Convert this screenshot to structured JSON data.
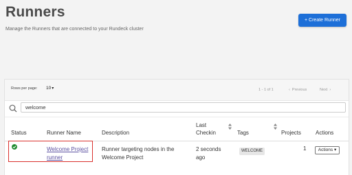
{
  "header": {
    "title": "Runners",
    "subtitle": "Manage the Runners that are connected to your Rundeck cluster",
    "create_button": "+ Create Runner"
  },
  "pager": {
    "rows_per_page_label": "Rows per page:",
    "rows_per_page_value": "10",
    "range": "1 - 1 of 1",
    "previous": "Previous",
    "next": "Next"
  },
  "search": {
    "value": "welcome"
  },
  "table": {
    "columns": {
      "status": "Status",
      "runner_name": "Runner Name",
      "description": "Description",
      "last_checkin_1": "Last",
      "last_checkin_2": "Checkin",
      "tags": "Tags",
      "projects": "Projects",
      "actions": "Actions"
    },
    "rows": [
      {
        "status": "ok",
        "runner_name_1": "Welcome Project",
        "runner_name_2": "runner",
        "description_1": "Runner targeting nodes in the",
        "description_2": "Welcome Project",
        "last_checkin_1": "2 seconds",
        "last_checkin_2": "ago",
        "tag": "WELCOME",
        "projects": "1",
        "actions": "Actions"
      }
    ]
  },
  "colors": {
    "primary": "#1d6fd8",
    "status_ok": "#1e8a2e",
    "highlight": "#d9302c",
    "link": "#5a4fa0"
  }
}
